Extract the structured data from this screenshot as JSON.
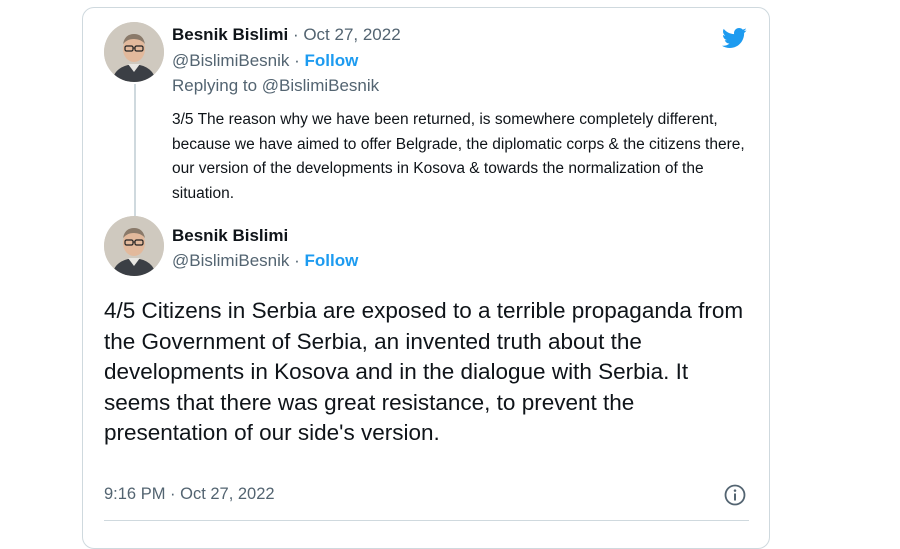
{
  "reply_tweet": {
    "author_name": "Besnik Bislimi",
    "date": "Oct 27, 2022",
    "handle": "@BislimiBesnik",
    "follow_label": "Follow",
    "replying_to": "Replying to @BislimiBesnik",
    "text": "3/5 The reason why we have been returned, is somewhere completely different, because we have aimed to offer Belgrade, the diplomatic corps & the citizens there, our version of the developments in Kosova & towards the normalization of the situation."
  },
  "main_tweet": {
    "author_name": "Besnik Bislimi",
    "handle": "@BislimiBesnik",
    "follow_label": "Follow",
    "text": "4/5 Citizens in Serbia are exposed to a terrible propaganda from the Government of Serbia, an invented truth about the developments in Kosova and in the dialogue with Serbia. It seems that there was great resistance, to prevent the presentation of our side's version.",
    "timestamp": "9:16 PM · Oct 27, 2022"
  },
  "icons": {
    "brand": "twitter-bird-icon",
    "info": "info-icon"
  },
  "colors": {
    "accent": "#1d9bf0",
    "text": "#0f1419",
    "secondary_text": "#536471",
    "border": "#cfd9de"
  }
}
